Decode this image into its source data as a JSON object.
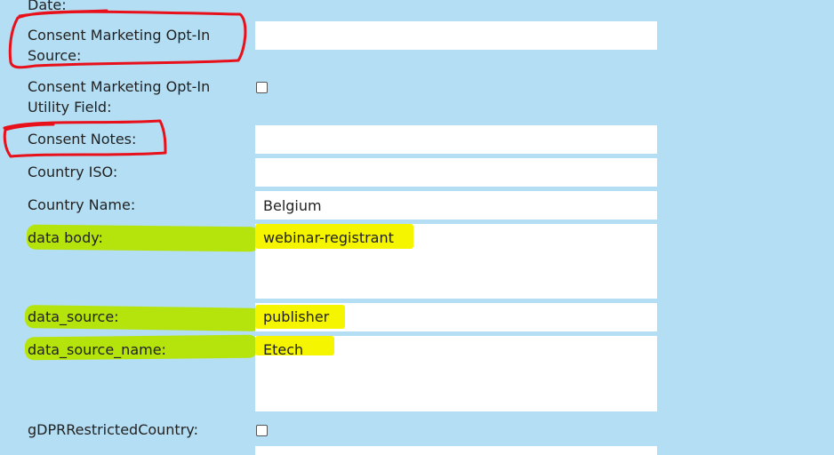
{
  "form": {
    "rows": [
      {
        "label": "Date:"
      },
      {
        "label": "Consent Marketing Opt-In Source:",
        "value": ""
      },
      {
        "label": "Consent Marketing Opt-In Utility Field:",
        "checked": false
      },
      {
        "label": "Consent Notes:",
        "value": ""
      },
      {
        "label": "Country ISO:",
        "value": ""
      },
      {
        "label": "Country Name:",
        "value": "Belgium"
      },
      {
        "label": "data body:",
        "value": "webinar-registrant"
      },
      {
        "label": "data_source:",
        "value": "publisher"
      },
      {
        "label": "data_source_name:",
        "value": "Etech"
      },
      {
        "label": "gDPRRestrictedCountry:",
        "checked": false
      }
    ]
  },
  "annotations": {
    "circle_color": "#e8101a",
    "label_highlight_color": "#b5e400",
    "value_highlight_color": "#f5f500"
  }
}
